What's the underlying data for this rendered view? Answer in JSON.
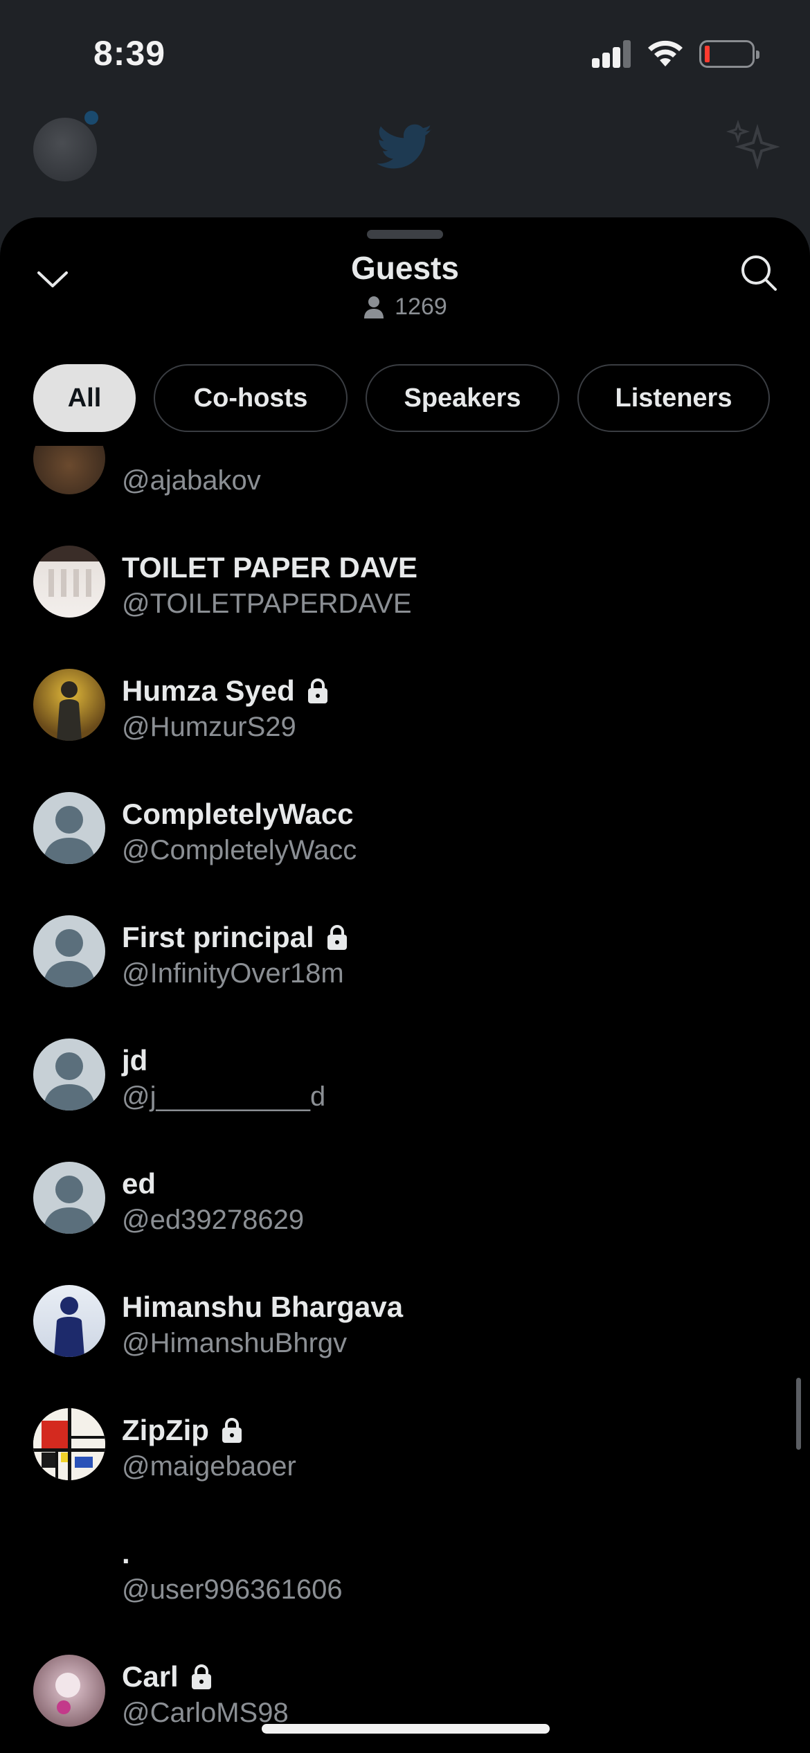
{
  "status_bar": {
    "time": "8:39"
  },
  "sheet": {
    "title": "Guests",
    "guest_count": "1269",
    "tabs": [
      {
        "label": "All",
        "active": true
      },
      {
        "label": "Co-hosts",
        "active": false
      },
      {
        "label": "Speakers",
        "active": false
      },
      {
        "label": "Listeners",
        "active": false
      }
    ]
  },
  "guests": [
    {
      "name": "",
      "handle": "@ajabakov",
      "locked": false,
      "avatar": "photo-dark"
    },
    {
      "name": "TOILET PAPER DAVE",
      "handle": "@TOILETPAPERDAVE",
      "locked": false,
      "avatar": "photo-light"
    },
    {
      "name": "Humza Syed",
      "handle": "@HumzurS29",
      "locked": true,
      "avatar": "photo-yellow"
    },
    {
      "name": "CompletelyWacc",
      "handle": "@CompletelyWacc",
      "locked": false,
      "avatar": "default"
    },
    {
      "name": "First principal",
      "handle": "@InfinityOver18m",
      "locked": true,
      "avatar": "default"
    },
    {
      "name": "jd",
      "handle": "@j__________d",
      "locked": false,
      "avatar": "default"
    },
    {
      "name": "ed",
      "handle": "@ed39278629",
      "locked": false,
      "avatar": "default"
    },
    {
      "name": "Himanshu Bhargava",
      "handle": "@HimanshuBhrgv",
      "locked": false,
      "avatar": "photo-blue"
    },
    {
      "name": "ZipZip",
      "handle": "@maigebaoer",
      "locked": true,
      "avatar": "mondrian"
    },
    {
      "name": ".",
      "handle": "@user996361606",
      "locked": false,
      "avatar": "none"
    },
    {
      "name": "Carl",
      "handle": "@CarloMS98",
      "locked": true,
      "avatar": "photo-pink"
    }
  ],
  "colors": {
    "accent": "#e1e1e1",
    "muted_text": "#8b8f94",
    "background": "#000000"
  }
}
